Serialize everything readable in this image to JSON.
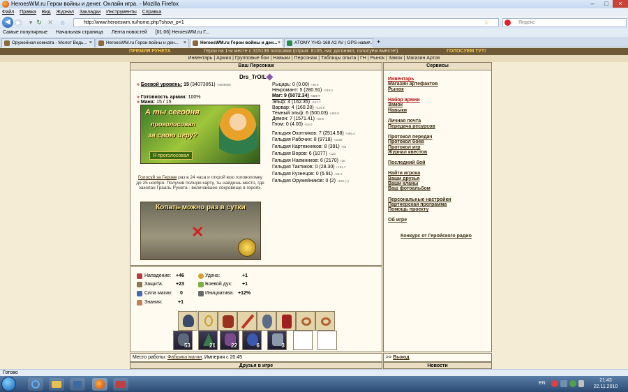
{
  "window": {
    "title": "HeroesWM.ru Герои войны и денег. Онлайн игра. - Mozilla Firefox"
  },
  "menu": [
    "Файл",
    "Правка",
    "Вид",
    "Журнал",
    "Закладки",
    "Инструменты",
    "Справка"
  ],
  "url": "http://www.heroeswm.ru/home.php?show_p=1",
  "search_placeholder": "Яндекс",
  "bookmarks": [
    "Самые популярные",
    "Начальная страница",
    "Лента новостей",
    "[01:06] HeroesWM.ru Г..."
  ],
  "tabs": [
    "Оружейная комната - Молот Ведь...",
    "HeroesWM.ru Герои войны и ден...",
    "HeroesWM.ru Герои войны и ден...",
    "ATOMY YHG-168 A2 AV | GPS-нави..."
  ],
  "promo": {
    "left": "ПРЕМИЯ РУНЕТА",
    "center": "Герои на 1-м месте с 315138 голосами (отрыв: 8135, нас догоняют, голосуем вместе!)",
    "right": "ГОЛОСУЕМ ТУТ!"
  },
  "gamenav": "Инвентарь | Армия | Групповые бои | Навыки | Персонаж | Таблицы опыта | ГН | Рынок | Замок | Магазин Артов",
  "left_panel": {
    "header": "Ваш Персонаж",
    "name": "Drs_TrOlL",
    "level_label": "Боевой уровень:",
    "level_value": "15",
    "level_exp": "(34073051)",
    "level_small": "+8509808",
    "readiness_label": "Готовность армии:",
    "readiness_value": "100%",
    "mana_label": "Мана:",
    "mana_value": "15 / 15",
    "classes": [
      {
        "text": "Рыцарь: 0 (0.00)",
        "small": "+30.0"
      },
      {
        "text": "Некромант: 5 (280.91)",
        "small": "+219.1"
      },
      {
        "text": "Маг: 9 (5072.34)",
        "small": "+327.7"
      },
      {
        "text": "Эльф: 4 (162.35)",
        "small": "+117.7"
      },
      {
        "text": "Варвар: 4 (160.20)",
        "small": "+119.8"
      },
      {
        "text": "Темный эльф: 6 (500.03)",
        "small": "+450.0"
      },
      {
        "text": "Демон: 7 (1571.41)",
        "small": "+28.6"
      },
      {
        "text": "Гном: 0 (4.00)",
        "small": "+16.0"
      }
    ],
    "guilds": [
      {
        "text": "Гильдия Охотников: 7 (2514.58)",
        "small": "+485.4"
      },
      {
        "text": "Гильдия Рабочих: 8 (9718)",
        "small": "+2282"
      },
      {
        "text": "Гильдия Картежников: 8 (391)",
        "small": "+59"
      },
      {
        "text": "Гильдия Воров: 6 (1077)",
        "small": "+123"
      },
      {
        "text": "Гильдия Наемников: 6 (2170)",
        "small": "+30"
      },
      {
        "text": "Гильдия Тактиков: 0 (28.30)",
        "small": "+131.7"
      },
      {
        "text": "Гильдия Кузнецов: 0 (6.91)",
        "small": "+23.1"
      },
      {
        "text": "Гильдия Оружейников: 0 (2)",
        "small": "+100 (+)"
      }
    ],
    "banner1": {
      "line1": "А ты сегодня",
      "line2": "проголосовал",
      "line3": "за свою игру?",
      "button": "Я проголосовал"
    },
    "vote_text_link": "Голосуй за Героев",
    "vote_text": "раз в 24 часа и открой всю головоломку до 25 ноября. Получив полную карту, ты найдешь место, где закопан Грааль Рунета - величайшее сокровище в героях.",
    "banner2": {
      "title": "Копать можно раз в сутки"
    }
  },
  "stats": [
    {
      "label": "Нападение:",
      "value": "+46"
    },
    {
      "label": "Защита:",
      "value": "+23"
    },
    {
      "label": "Сила магии:",
      "value": "0"
    },
    {
      "label": "Знания:",
      "value": "+1"
    },
    {
      "label": "Удача:",
      "value": "+1"
    },
    {
      "label": "Боевой дух:",
      "value": "+1"
    },
    {
      "label": "Инициатива:",
      "value": "+12%"
    }
  ],
  "army_counts": [
    "53",
    "21",
    "22",
    "6",
    "3"
  ],
  "work": {
    "label": "Место работы:",
    "place": "Фабрика магии",
    "suffix": ", Империя с 20:45"
  },
  "exit": {
    "prefix": ">>",
    "label": "Выход"
  },
  "friends_header": "Друзья в игре",
  "news_header": "Новости",
  "services": {
    "header": "Сервисы",
    "items": [
      "Инвентарь",
      "Магазин артефактов",
      "Рынок",
      "Набор армии",
      "Замок",
      "Навыки",
      "Личная почта",
      "Передача ресурсов",
      "Протокол передач",
      "Протокол боев",
      "Протокол игр",
      "Журнал квестов",
      "Последний бой",
      "Найти игрока",
      "Ваши друзья",
      "Ваши кланы",
      "Ваш фотоальбом",
      "Персональные настройки",
      "Партнерская программа",
      "Помощь проекту",
      "Об игре",
      "Конкурс от Геройского радио"
    ]
  },
  "statusbar": "Готово",
  "taskbar": {
    "lang": "EN",
    "time": "21:43",
    "date": "22.11.2010"
  },
  "colors": {
    "accent_red": "#b01010",
    "link": "#3a2a10",
    "bg": "#f5ecd5"
  }
}
